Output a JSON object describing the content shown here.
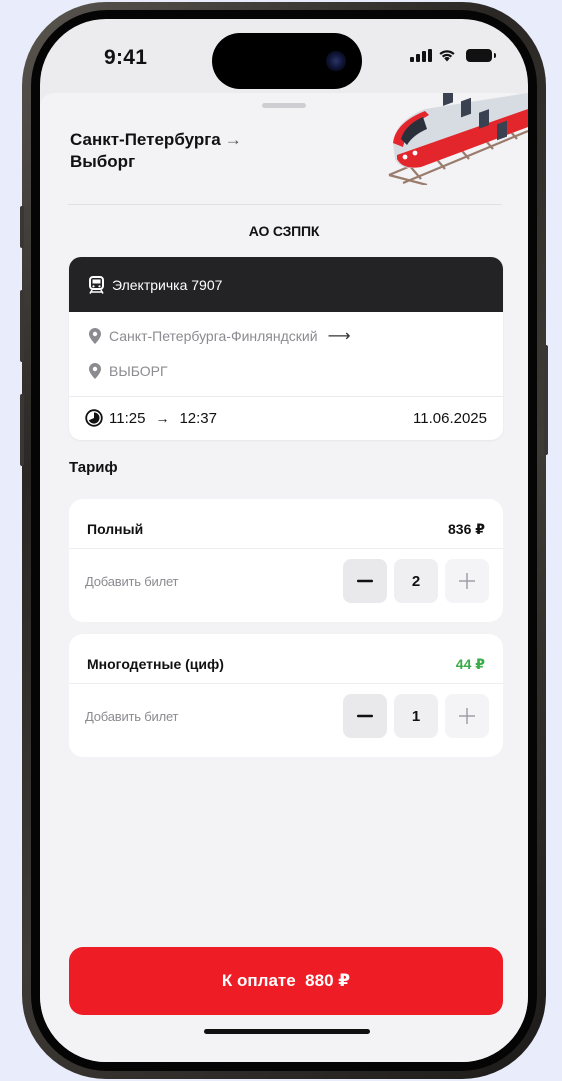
{
  "status_bar": {
    "time": "9:41"
  },
  "header": {
    "origin": "Санкт-Петербурга",
    "arrow": "→",
    "destination": "Выборг",
    "carrier": "АО СЗППК"
  },
  "trip": {
    "train_name": "Электричка 7907",
    "from_station": "Санкт-Петербурга-Финляндский",
    "from_arrow": "⟶",
    "to_station": "ВЫБОРГ",
    "departure": "11:25",
    "time_arrow": "→",
    "arrival": "12:37",
    "date": "11.06.2025"
  },
  "tariff": {
    "title": "Тариф",
    "fares": [
      {
        "name": "Полный",
        "price": "836 ₽",
        "price_color": "#111111",
        "add_label": "Добавить билет",
        "quantity": "2"
      },
      {
        "name": "Многодетные (циф)",
        "price": "44 ₽",
        "price_color": "#3bab4a",
        "add_label": "Добавить билет",
        "quantity": "1"
      }
    ]
  },
  "pay_button": {
    "label": "К оплате  880 ₽"
  },
  "colors": {
    "accent": "#ee1c25",
    "card_header": "#232325",
    "discount_price": "#3bab4a"
  },
  "icons": [
    "train-icon",
    "location-pin-icon",
    "clock-icon",
    "minus-icon",
    "plus-icon",
    "signal-icon",
    "wifi-icon",
    "battery-icon"
  ]
}
